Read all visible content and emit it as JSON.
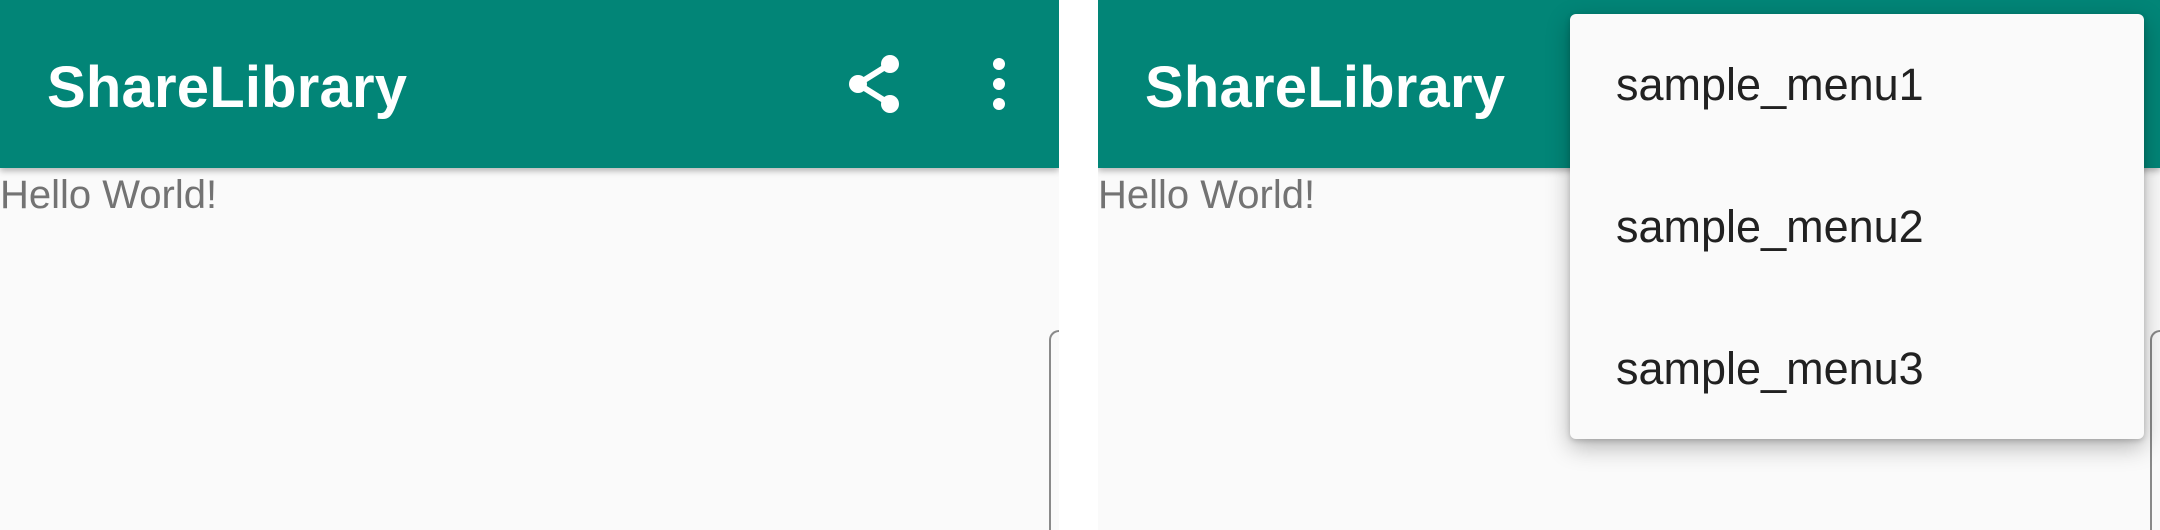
{
  "screens": [
    {
      "app_bar": {
        "title": "ShareLibrary",
        "actions": [
          "share-icon",
          "more-vert-icon"
        ]
      },
      "content": {
        "text": "Hello World!"
      }
    },
    {
      "app_bar": {
        "title": "ShareLibrary"
      },
      "content": {
        "text": "Hello World!"
      },
      "overflow_menu": {
        "items": [
          "sample_menu1",
          "sample_menu2",
          "sample_menu3"
        ]
      }
    }
  ],
  "colors": {
    "primary": "#028577",
    "background": "#fafafa",
    "on_primary": "#ffffff",
    "body_text": "#737373",
    "menu_text": "#212121"
  }
}
